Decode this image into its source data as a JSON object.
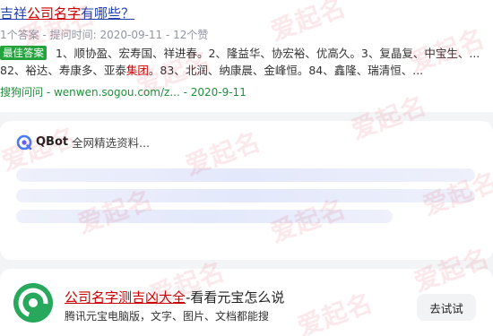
{
  "result": {
    "title_pre": "吉祥",
    "title_highlight": "公司名字",
    "title_post": "有哪些？",
    "meta": "1个答案 - 提问时间: 2020-09-11 - 12个赞",
    "badge": "最佳答案",
    "snippet_pre": "1、顺协盈、宏寿国、祥进春。2、隆益华、协宏裕、优高久。3、复晶复、中宝生、... 82、裕达、寿康多、亚泰",
    "snippet_highlight": "集团",
    "snippet_post": "。83、北润、纳康晨、金峰恒。84、鑫隆、瑞清恒、...",
    "source": "搜狗问问 - wenwen.sogou.com/z... - 2020-9-11"
  },
  "qbot": {
    "name": "QBot",
    "tagline": "全网精选资料..."
  },
  "promo": {
    "title_link": "公司名字测吉凶大全",
    "title_rest": "-看看元宝怎么说",
    "desc": "腾讯元宝电脑版，文字、图片、文档都能搜",
    "button": "去试试"
  },
  "watermark": "爱起名"
}
